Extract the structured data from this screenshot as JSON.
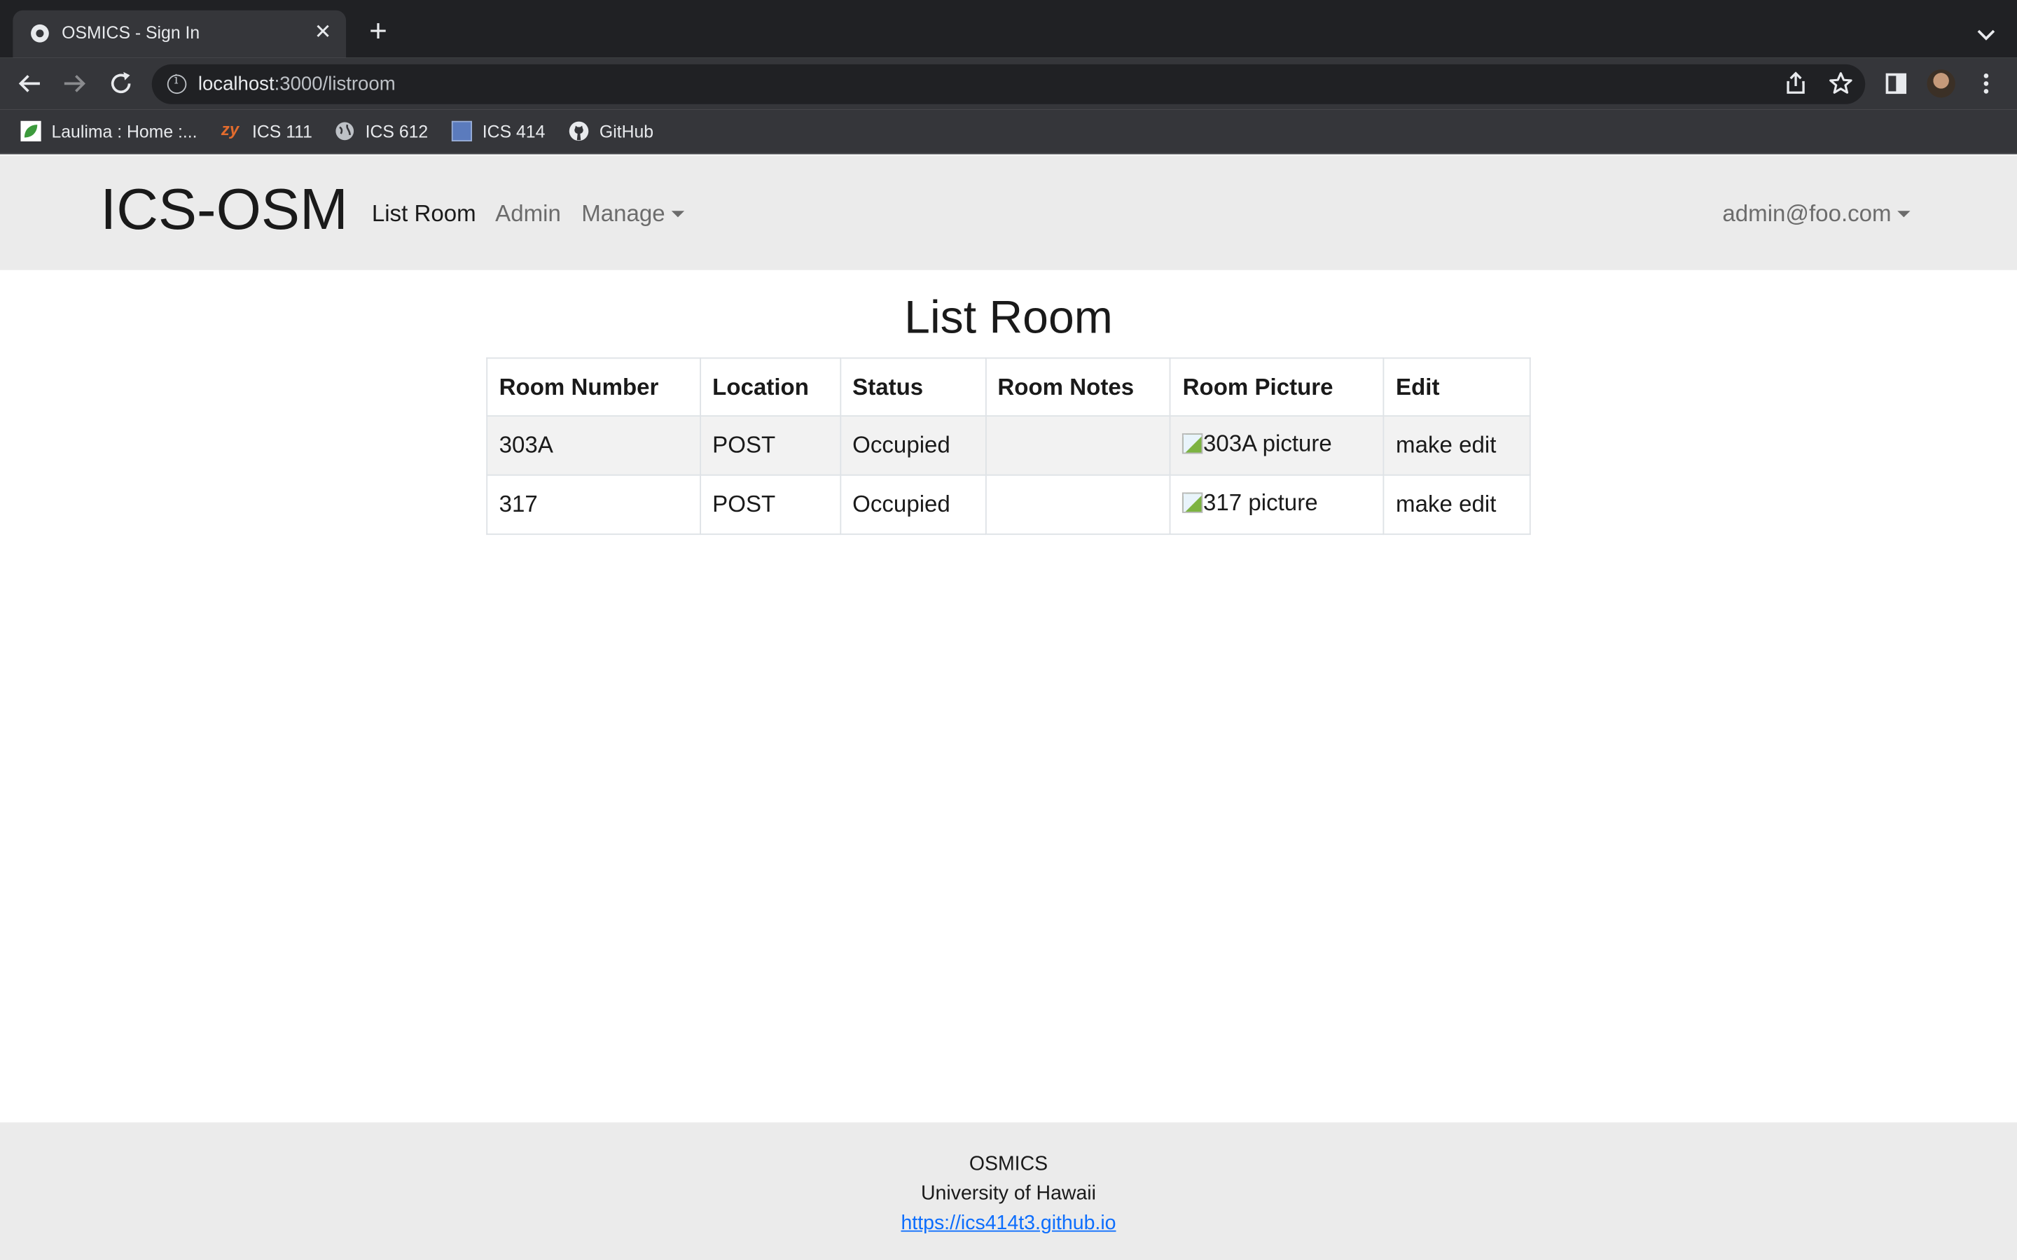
{
  "browser": {
    "tab_title": "OSMICS - Sign In",
    "url_host": "localhost",
    "url_path": ":3000/listroom",
    "bookmarks": [
      {
        "label": "Laulima : Home :...",
        "icon": "leaf-icon"
      },
      {
        "label": "ICS 111",
        "icon": "zybooks-icon"
      },
      {
        "label": "ICS 612",
        "icon": "globe-icon"
      },
      {
        "label": "ICS 414",
        "icon": "square-icon"
      },
      {
        "label": "GitHub",
        "icon": "github-icon"
      }
    ]
  },
  "navbar": {
    "brand": "ICS-OSM",
    "links": [
      "List Room",
      "Admin",
      "Manage"
    ],
    "user": "admin@foo.com"
  },
  "page": {
    "title": "List Room",
    "table": {
      "headers": [
        "Room Number",
        "Location",
        "Status",
        "Room Notes",
        "Room Picture",
        "Edit"
      ],
      "rows": [
        {
          "room": "303A",
          "location": "POST",
          "status": "Occupied",
          "notes": "",
          "picture_alt": "303A picture",
          "edit": "make edit"
        },
        {
          "room": "317",
          "location": "POST",
          "status": "Occupied",
          "notes": "",
          "picture_alt": "317 picture",
          "edit": "make edit"
        }
      ]
    }
  },
  "footer": {
    "line1": "OSMICS",
    "line2": "University of Hawaii",
    "link": "https://ics414t3.github.io"
  }
}
